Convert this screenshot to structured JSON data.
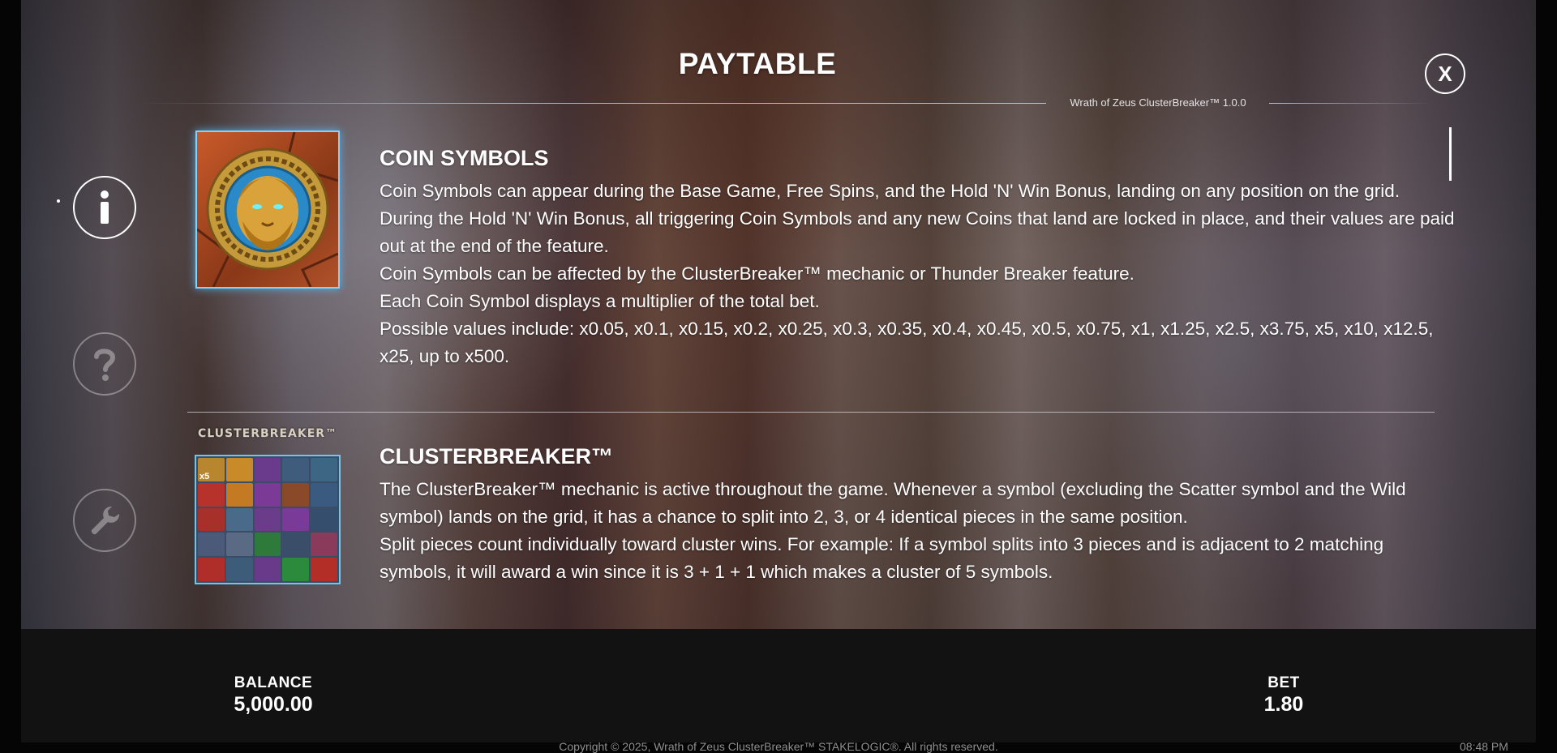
{
  "header": {
    "title": "PAYTABLE",
    "version": "Wrath of Zeus ClusterBreaker™ 1.0.0",
    "close_label": "X"
  },
  "nav": {
    "info_icon": "info-icon",
    "help_icon": "question-icon",
    "settings_icon": "wrench-icon"
  },
  "sections": {
    "coin": {
      "heading": "COIN SYMBOLS",
      "paragraphs": [
        "Coin Symbols can appear during the Base Game, Free Spins, and the Hold 'N' Win Bonus, landing on any position on the grid.",
        "During the Hold 'N' Win Bonus, all triggering Coin Symbols and any new Coins that land are locked in place, and their values are paid out at the end of the feature.",
        "Coin Symbols can be affected by the ClusterBreaker™ mechanic or Thunder Breaker feature.",
        "Each Coin Symbol displays a multiplier of the total bet.",
        "Possible values include: x0.05, x0.1, x0.15, x0.2, x0.25, x0.3, x0.35, x0.4, x0.45, x0.5, x0.75, x1, x1.25, x2.5, x3.75, x5, x10, x12.5, x25, up to x500."
      ]
    },
    "clusterbreaker": {
      "heading": "CLUSTERBREAKER™",
      "logo_text": "CLUSTERBREAKER™",
      "grid_badge": "x5",
      "paragraphs": [
        "The ClusterBreaker™ mechanic is active throughout the game. Whenever a symbol (excluding the Scatter symbol and the Wild symbol) lands on the grid, it has a chance to split into 2, 3, or 4 identical pieces in the same position.",
        "Split pieces count individually toward cluster wins. For example: If a symbol splits into 3 pieces and is adjacent to 2 matching symbols, it will award a win since it is 3 + 1 + 1 which makes a cluster of 5 symbols."
      ]
    }
  },
  "bottom": {
    "balance_label": "BALANCE",
    "balance_value": "5,000.00",
    "bet_label": "BET",
    "bet_value": "1.80"
  },
  "footer": {
    "copyright": "Copyright © 2025, Wrath of Zeus ClusterBreaker™ STAKELOGIC®. All rights reserved.",
    "time": "08:48 PM"
  },
  "colors": {
    "accent_blue": "#7fd3ff",
    "bottom_bar": "#121212"
  }
}
